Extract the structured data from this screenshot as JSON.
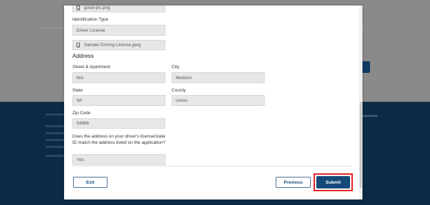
{
  "uploads": {
    "photo_file": "good-pic.png",
    "license_file": "Sample Driving License.jpeg"
  },
  "identification": {
    "label": "Identification Type",
    "value": "Driver License"
  },
  "address": {
    "heading": "Address",
    "street_label": "Street & Apartment",
    "street_value": "this",
    "city_label": "City",
    "city_value": "Medosn",
    "state_label": "State",
    "state_value": "WI",
    "county_label": "County",
    "county_value": "Union",
    "zip_label": "Zip Code",
    "zip_value": "54986"
  },
  "match_question": {
    "label": "Does the address on your driver's license/state ID match the address listed on the application?",
    "value": "Yes"
  },
  "actions": {
    "exit_label": "Exit",
    "previous_label": "Previous",
    "submit_label": "Submit"
  },
  "colors": {
    "primary": "#144a7a",
    "highlight": "#e02020",
    "footer": "#0d2a45"
  }
}
